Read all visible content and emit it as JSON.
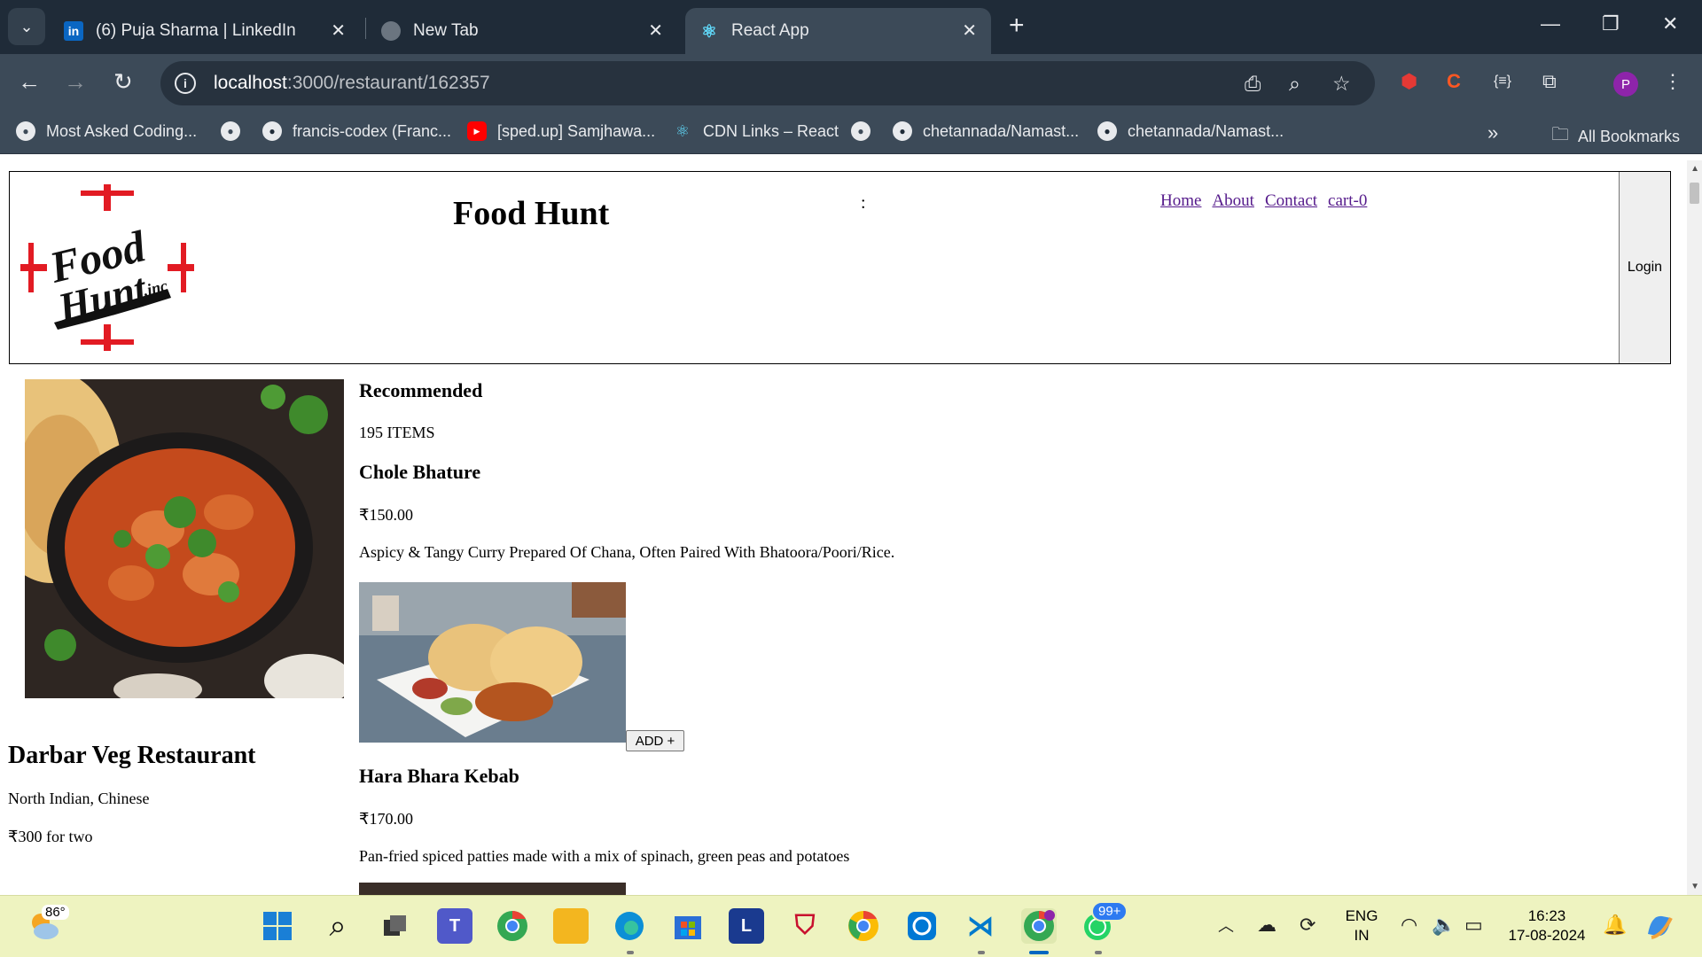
{
  "browser": {
    "tabs": [
      {
        "title": "(6) Puja Sharma | LinkedIn",
        "icon": "linkedin-icon",
        "active": false
      },
      {
        "title": "New Tab",
        "icon": "chrome-icon",
        "active": false
      },
      {
        "title": "React App",
        "icon": "react-icon",
        "active": true
      }
    ],
    "url_host": "localhost",
    "url_path": ":3000/restaurant/162357",
    "profile_initial": "P",
    "bookmarks": [
      "Most Asked Coding...",
      "francis-codex (Franc...",
      "[sped.up] Samjhawa...",
      "CDN Links – React",
      "chetannada/Namast...",
      "chetannada/Namast...",
      "All Bookmarks"
    ]
  },
  "header": {
    "title": "Food Hunt",
    "colon": ":",
    "nav": [
      "Home",
      "About",
      "Contact",
      "cart-0"
    ],
    "login_label": "Login",
    "logo_text_1": "Food",
    "logo_text_2": "Hunt",
    "logo_text_3": ".inc"
  },
  "restaurant": {
    "name": "Darbar Veg Restaurant",
    "cuisines": "North Indian, Chinese",
    "cost": "₹300 for two"
  },
  "menu": {
    "heading": "Recommended",
    "count": "195 ITEMS",
    "items": [
      {
        "name": "Chole Bhature",
        "price": "₹150.00",
        "description": "Aspicy & Tangy Curry Prepared Of Chana, Often Paired With Bhatoora/Poori/Rice.",
        "add_label": "ADD +"
      },
      {
        "name": "Hara Bhara Kebab",
        "price": "₹170.00",
        "description": "Pan-fried spiced patties made with a mix of spinach, green peas and potatoes"
      }
    ]
  },
  "taskbar": {
    "temperature": "86°",
    "notification_badge": "99+",
    "language_1": "ENG",
    "language_2": "IN",
    "time": "16:23",
    "date": "17-08-2024"
  },
  "colors": {
    "tabbar": "#1f2b38",
    "toolbar": "#3c4a58",
    "link": "#551a8b",
    "taskbar": "#eef3c0"
  }
}
